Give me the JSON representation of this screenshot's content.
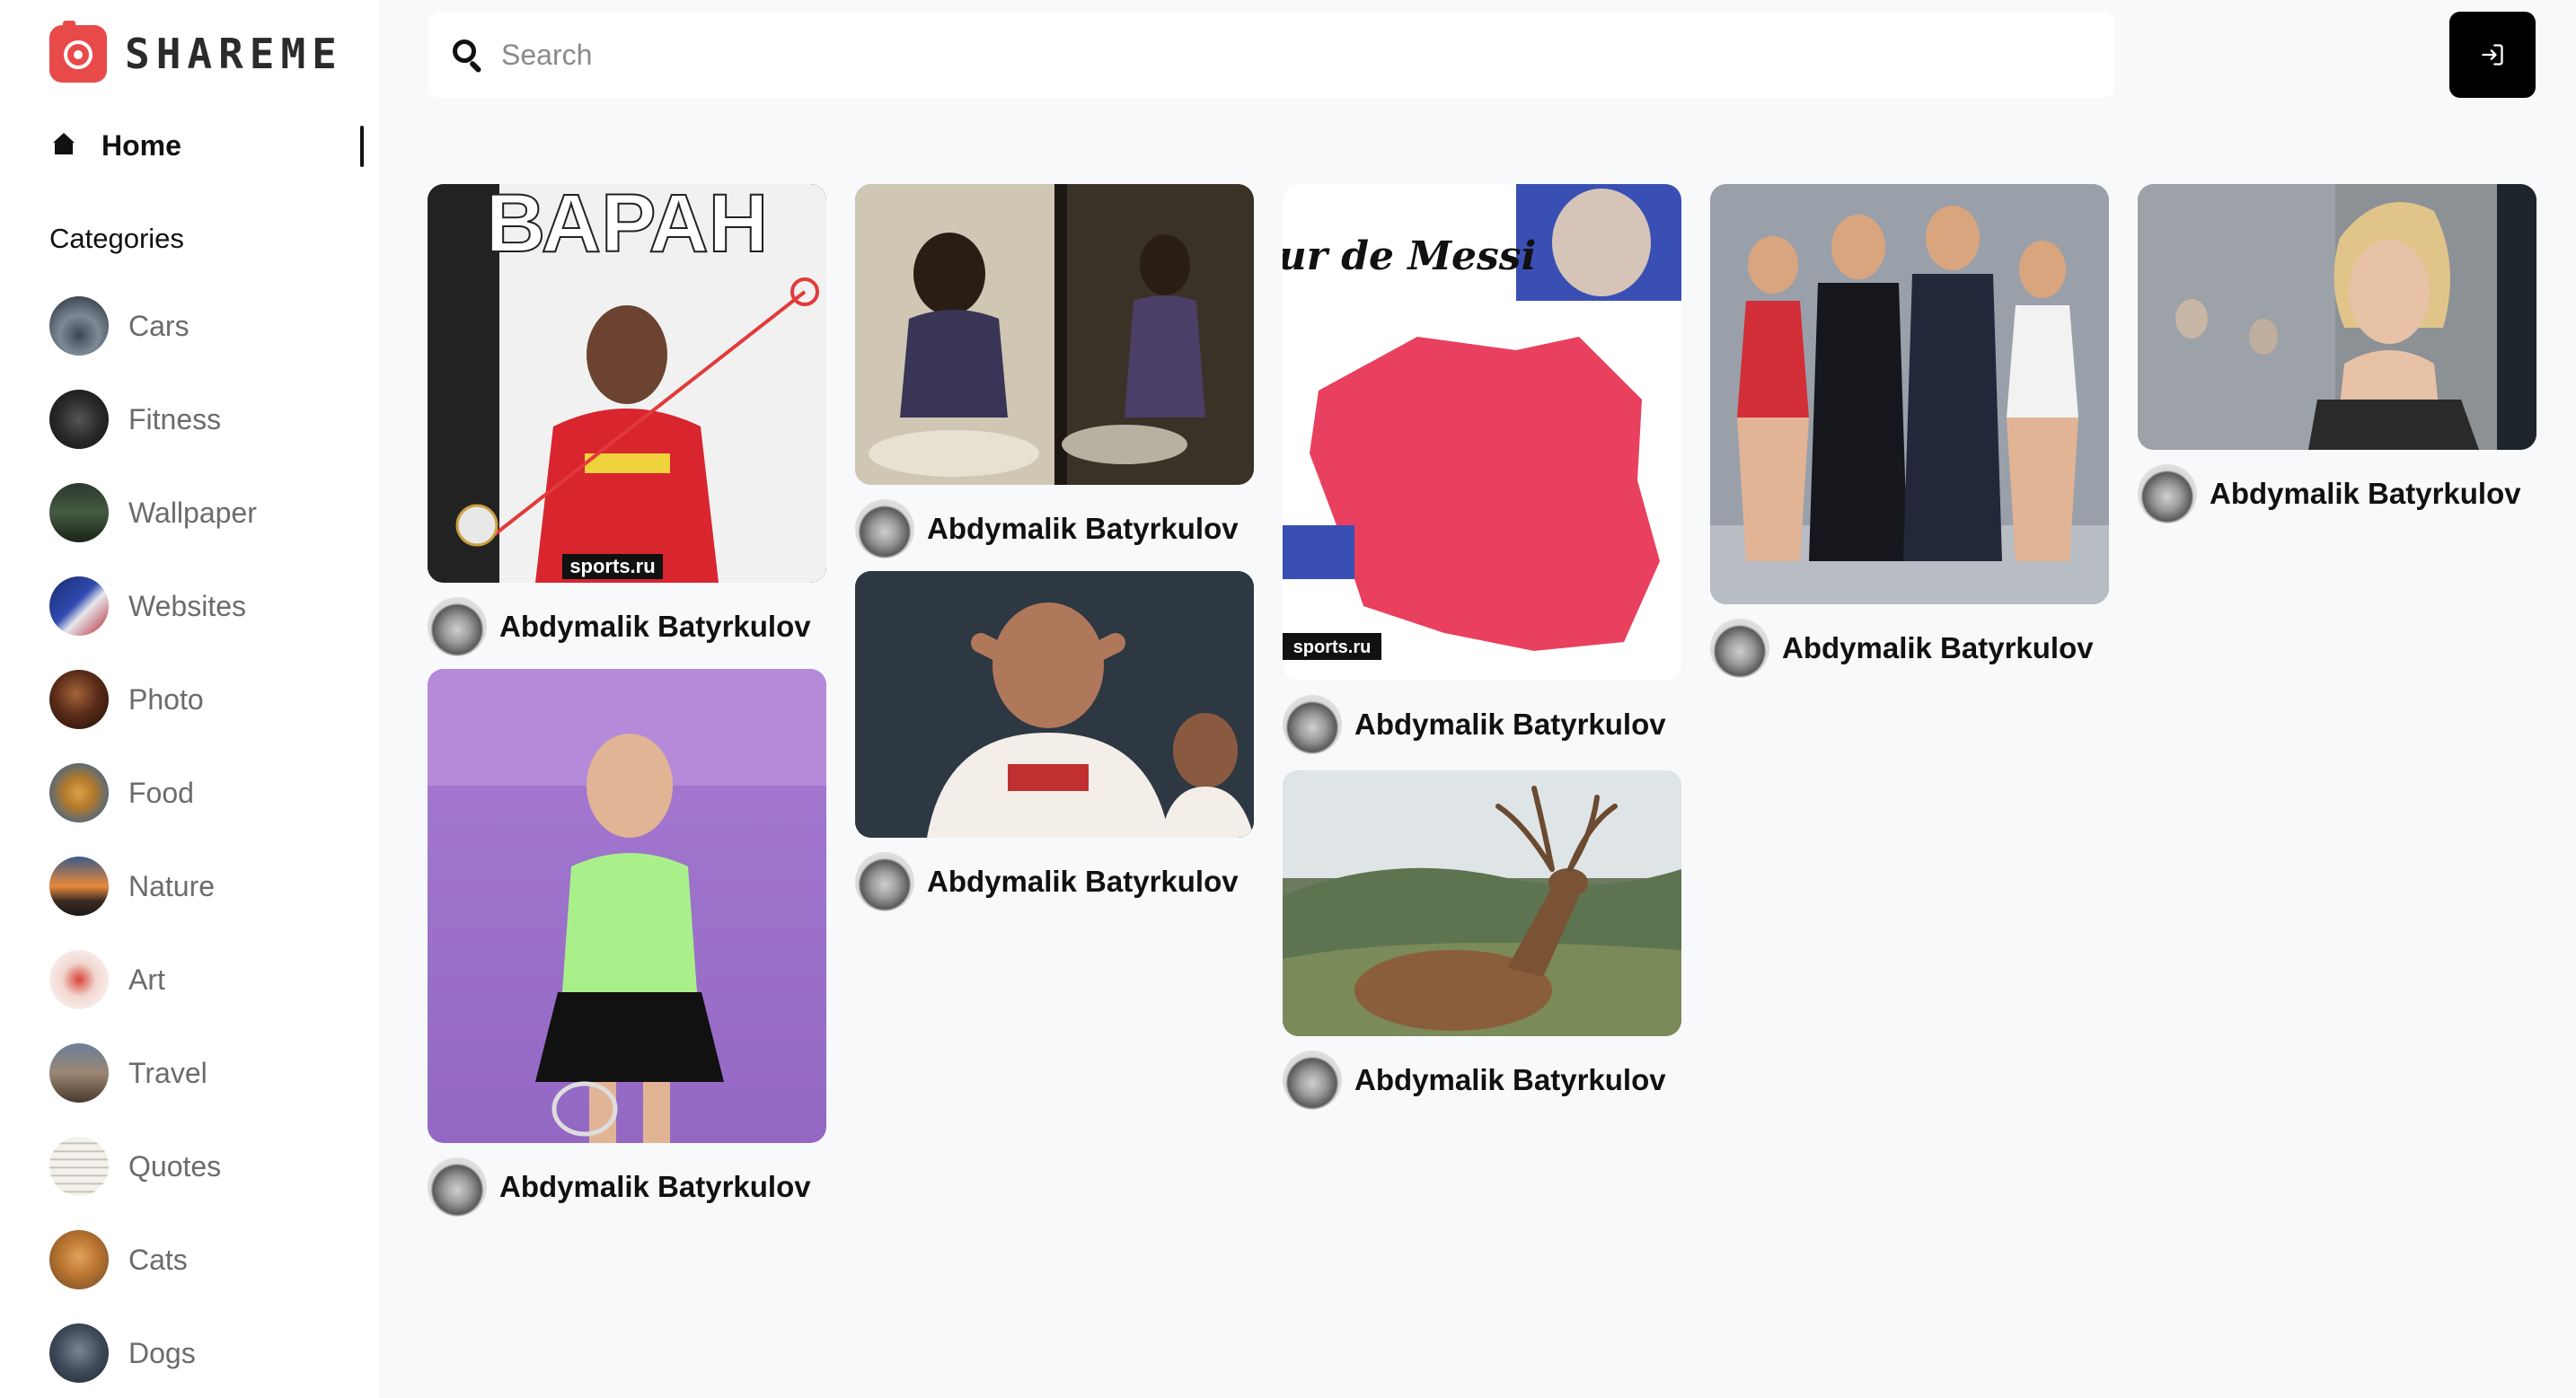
{
  "app": {
    "name": "SHAREME"
  },
  "nav": {
    "home_label": "Home"
  },
  "categories": {
    "heading": "Categories",
    "items": [
      {
        "label": "Cars",
        "icon": "cars-thumbnail"
      },
      {
        "label": "Fitness",
        "icon": "fitness-thumbnail"
      },
      {
        "label": "Wallpaper",
        "icon": "wallpaper-thumbnail"
      },
      {
        "label": "Websites",
        "icon": "websites-thumbnail"
      },
      {
        "label": "Photo",
        "icon": "photo-thumbnail"
      },
      {
        "label": "Food",
        "icon": "food-thumbnail"
      },
      {
        "label": "Nature",
        "icon": "nature-thumbnail"
      },
      {
        "label": "Art",
        "icon": "art-thumbnail"
      },
      {
        "label": "Travel",
        "icon": "travel-thumbnail"
      },
      {
        "label": "Quotes",
        "icon": "quotes-thumbnail"
      },
      {
        "label": "Cats",
        "icon": "cats-thumbnail"
      },
      {
        "label": "Dogs",
        "icon": "dogs-thumbnail"
      }
    ]
  },
  "search": {
    "placeholder": "Search",
    "value": ""
  },
  "header": {
    "login_icon": "login-icon"
  },
  "pins": [
    {
      "author": "Abdymalik Batyrkulov",
      "image_text": {
        "title": "ВАРАН",
        "brand": "sports.ru"
      }
    },
    {
      "author": "Abdymalik Batyrkulov"
    },
    {
      "author": "Abdymalik Batyrkulov"
    },
    {
      "author": "Abdymalik Batyrkulov"
    },
    {
      "author": "Abdymalik Batyrkulov",
      "image_text": {
        "title": "Tour de Messi",
        "brand": "sports.ru"
      }
    },
    {
      "author": "Abdymalik Batyrkulov"
    },
    {
      "author": "Abdymalik Batyrkulov"
    },
    {
      "author": "Abdymalik Batyrkulov"
    }
  ],
  "colors": {
    "brand": "#e84a4a",
    "sidebar_bg": "#ffffff",
    "page_bg": "#f8f9fb"
  }
}
